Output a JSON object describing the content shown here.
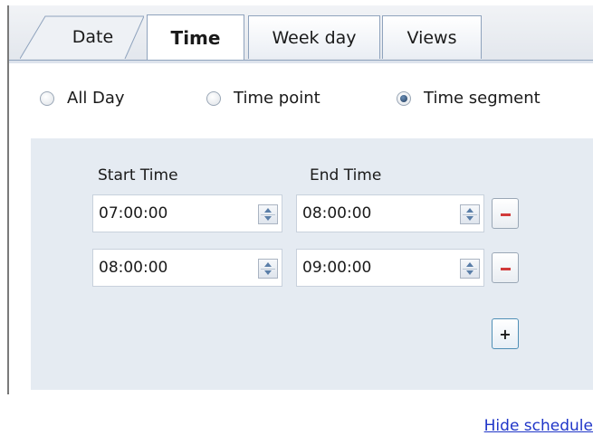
{
  "tabs": {
    "date": "Date",
    "time": "Time",
    "weekday": "Week day",
    "views": "Views",
    "active": "Time"
  },
  "mode": {
    "options": [
      "All Day",
      "Time point",
      "Time segment"
    ],
    "selected": "Time segment"
  },
  "schedule": {
    "start_header": "Start Time",
    "end_header": "End Time",
    "rows": [
      {
        "start": "07:00:00",
        "end": "08:00:00"
      },
      {
        "start": "08:00:00",
        "end": "09:00:00"
      }
    ],
    "add_label": "+"
  },
  "footer": {
    "link": "Hide schedule"
  },
  "colors": {
    "panel_bg": "#e5ebf2",
    "remove_accent": "#d13a3a",
    "link": "#1f35c8"
  },
  "icons": {
    "spin": "spinner-arrows-icon",
    "remove": "minus-icon",
    "add": "plus-icon"
  }
}
